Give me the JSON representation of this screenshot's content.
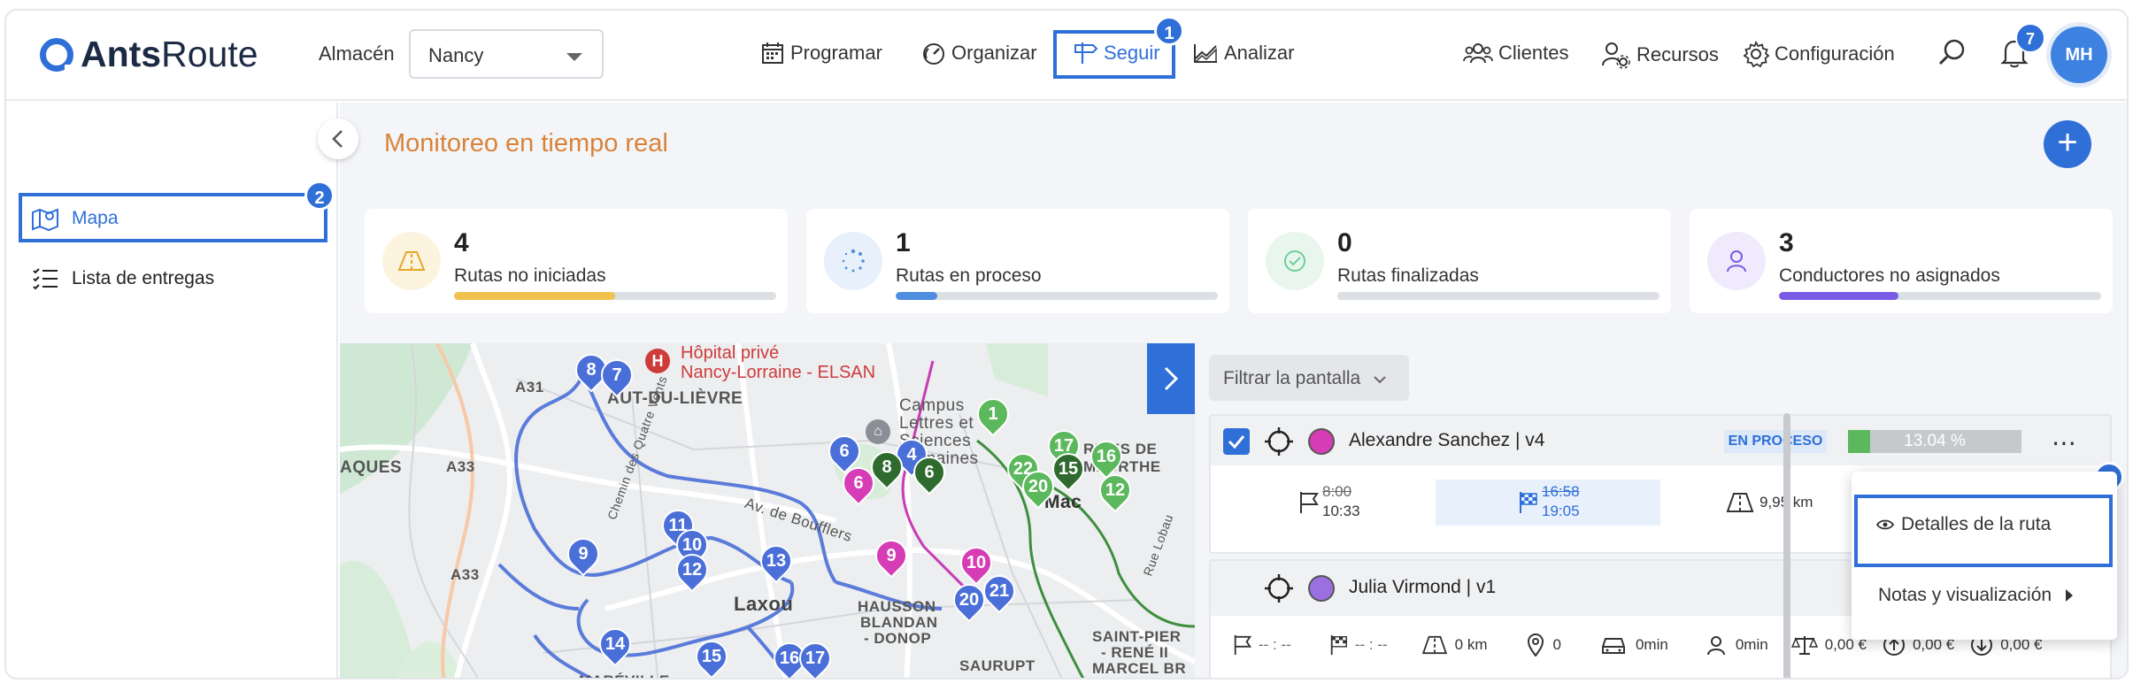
{
  "app": {
    "logo_bold": "Ants",
    "logo_light": "Route"
  },
  "header": {
    "almacen_label": "Almacén",
    "almacen_value": "Nancy",
    "nav": [
      {
        "label": "Programar",
        "icon": "calendar-icon"
      },
      {
        "label": "Organizar",
        "icon": "gauge-icon"
      },
      {
        "label": "Seguir",
        "icon": "signpost-icon",
        "active": true
      },
      {
        "label": "Analizar",
        "icon": "chart-icon"
      }
    ],
    "right_nav": [
      {
        "label": "Clientes",
        "icon": "clients-icon"
      },
      {
        "label": "Recursos",
        "icon": "resources-icon"
      },
      {
        "label": "Configuración",
        "icon": "gear-icon"
      }
    ],
    "notifications_count": "7",
    "avatar_initials": "MH"
  },
  "annotations": {
    "one": "1",
    "two": "2",
    "three": "3"
  },
  "sidebar": {
    "items": [
      {
        "label": "Mapa",
        "icon": "map-icon",
        "active": true
      },
      {
        "label": "Lista de entregas",
        "icon": "list-icon"
      }
    ]
  },
  "main": {
    "title": "Monitoreo en tiempo real",
    "add_label": "+",
    "stats": [
      {
        "count": "4",
        "label": "Rutas no iniciadas",
        "icon": "road-icon",
        "color": "#f2c14e",
        "progress": 0.5
      },
      {
        "count": "1",
        "label": "Rutas en proceso",
        "icon": "spinner-icon",
        "color": "#4d8ee0",
        "progress": 0.13
      },
      {
        "count": "0",
        "label": "Rutas finalizadas",
        "icon": "check-icon",
        "color": "#6fcf97",
        "progress": 0
      },
      {
        "count": "3",
        "label": "Conductores no asignados",
        "icon": "person-icon",
        "color": "#7a5ce6",
        "progress": 0.37
      }
    ]
  },
  "map": {
    "poi": "Hôpital privé",
    "poi_line2": "Nancy-Lorraine - ELSAN",
    "labels": [
      "A31",
      "A33",
      "A33",
      "AUT-DU-LIÈVRE",
      "AQUES",
      "Laxou",
      "Campus",
      "Lettres et",
      "Sciences",
      "Humaines",
      "RIVES DE",
      "MEURTHE",
      "HAUSSON",
      "BLANDAN",
      "- DONOP",
      "SAURUPT",
      "SAINT-PIER",
      "- RENÉ II",
      "MARCEL BR",
      "MARÉVILLE",
      "Av. de Boufflers",
      "Chemin des Quatre Vents",
      "Mac",
      "Rue Lobau"
    ],
    "pins_blue": [
      "8",
      "7",
      "9",
      "11",
      "10",
      "12",
      "13",
      "14",
      "15",
      "16",
      "17",
      "6",
      "4",
      "21",
      "20"
    ],
    "pins_green": [
      "1",
      "17",
      "16",
      "22",
      "20",
      "12",
      "15",
      "8",
      "6"
    ],
    "pins_magenta": [
      "9",
      "6",
      "10"
    ]
  },
  "routes": {
    "filter_label": "Filtrar la pantalla",
    "list": [
      {
        "driver": "Alexandre Sanchez | v4",
        "color": "#d63cb5",
        "status": "EN PROCESO",
        "progress_label": "13.04 %",
        "progress": 0.13,
        "start_planned": "8:00",
        "start_actual": "10:33",
        "end_planned": "16:58",
        "end_actual": "19:05",
        "distance": "9,95 km"
      },
      {
        "driver": "Julia Virmond | v1",
        "color": "#9b6fe0",
        "start": "-- : --",
        "end": "-- : --",
        "distance": "0 km",
        "stops": "0",
        "drive_time": "0min",
        "work_time": "0min",
        "cost1": "0,00 €",
        "cost2": "0,00 €",
        "cost3": "0,00 €"
      }
    ],
    "menu": {
      "details": "Detalles de la ruta",
      "notes": "Notas y visualización"
    }
  }
}
